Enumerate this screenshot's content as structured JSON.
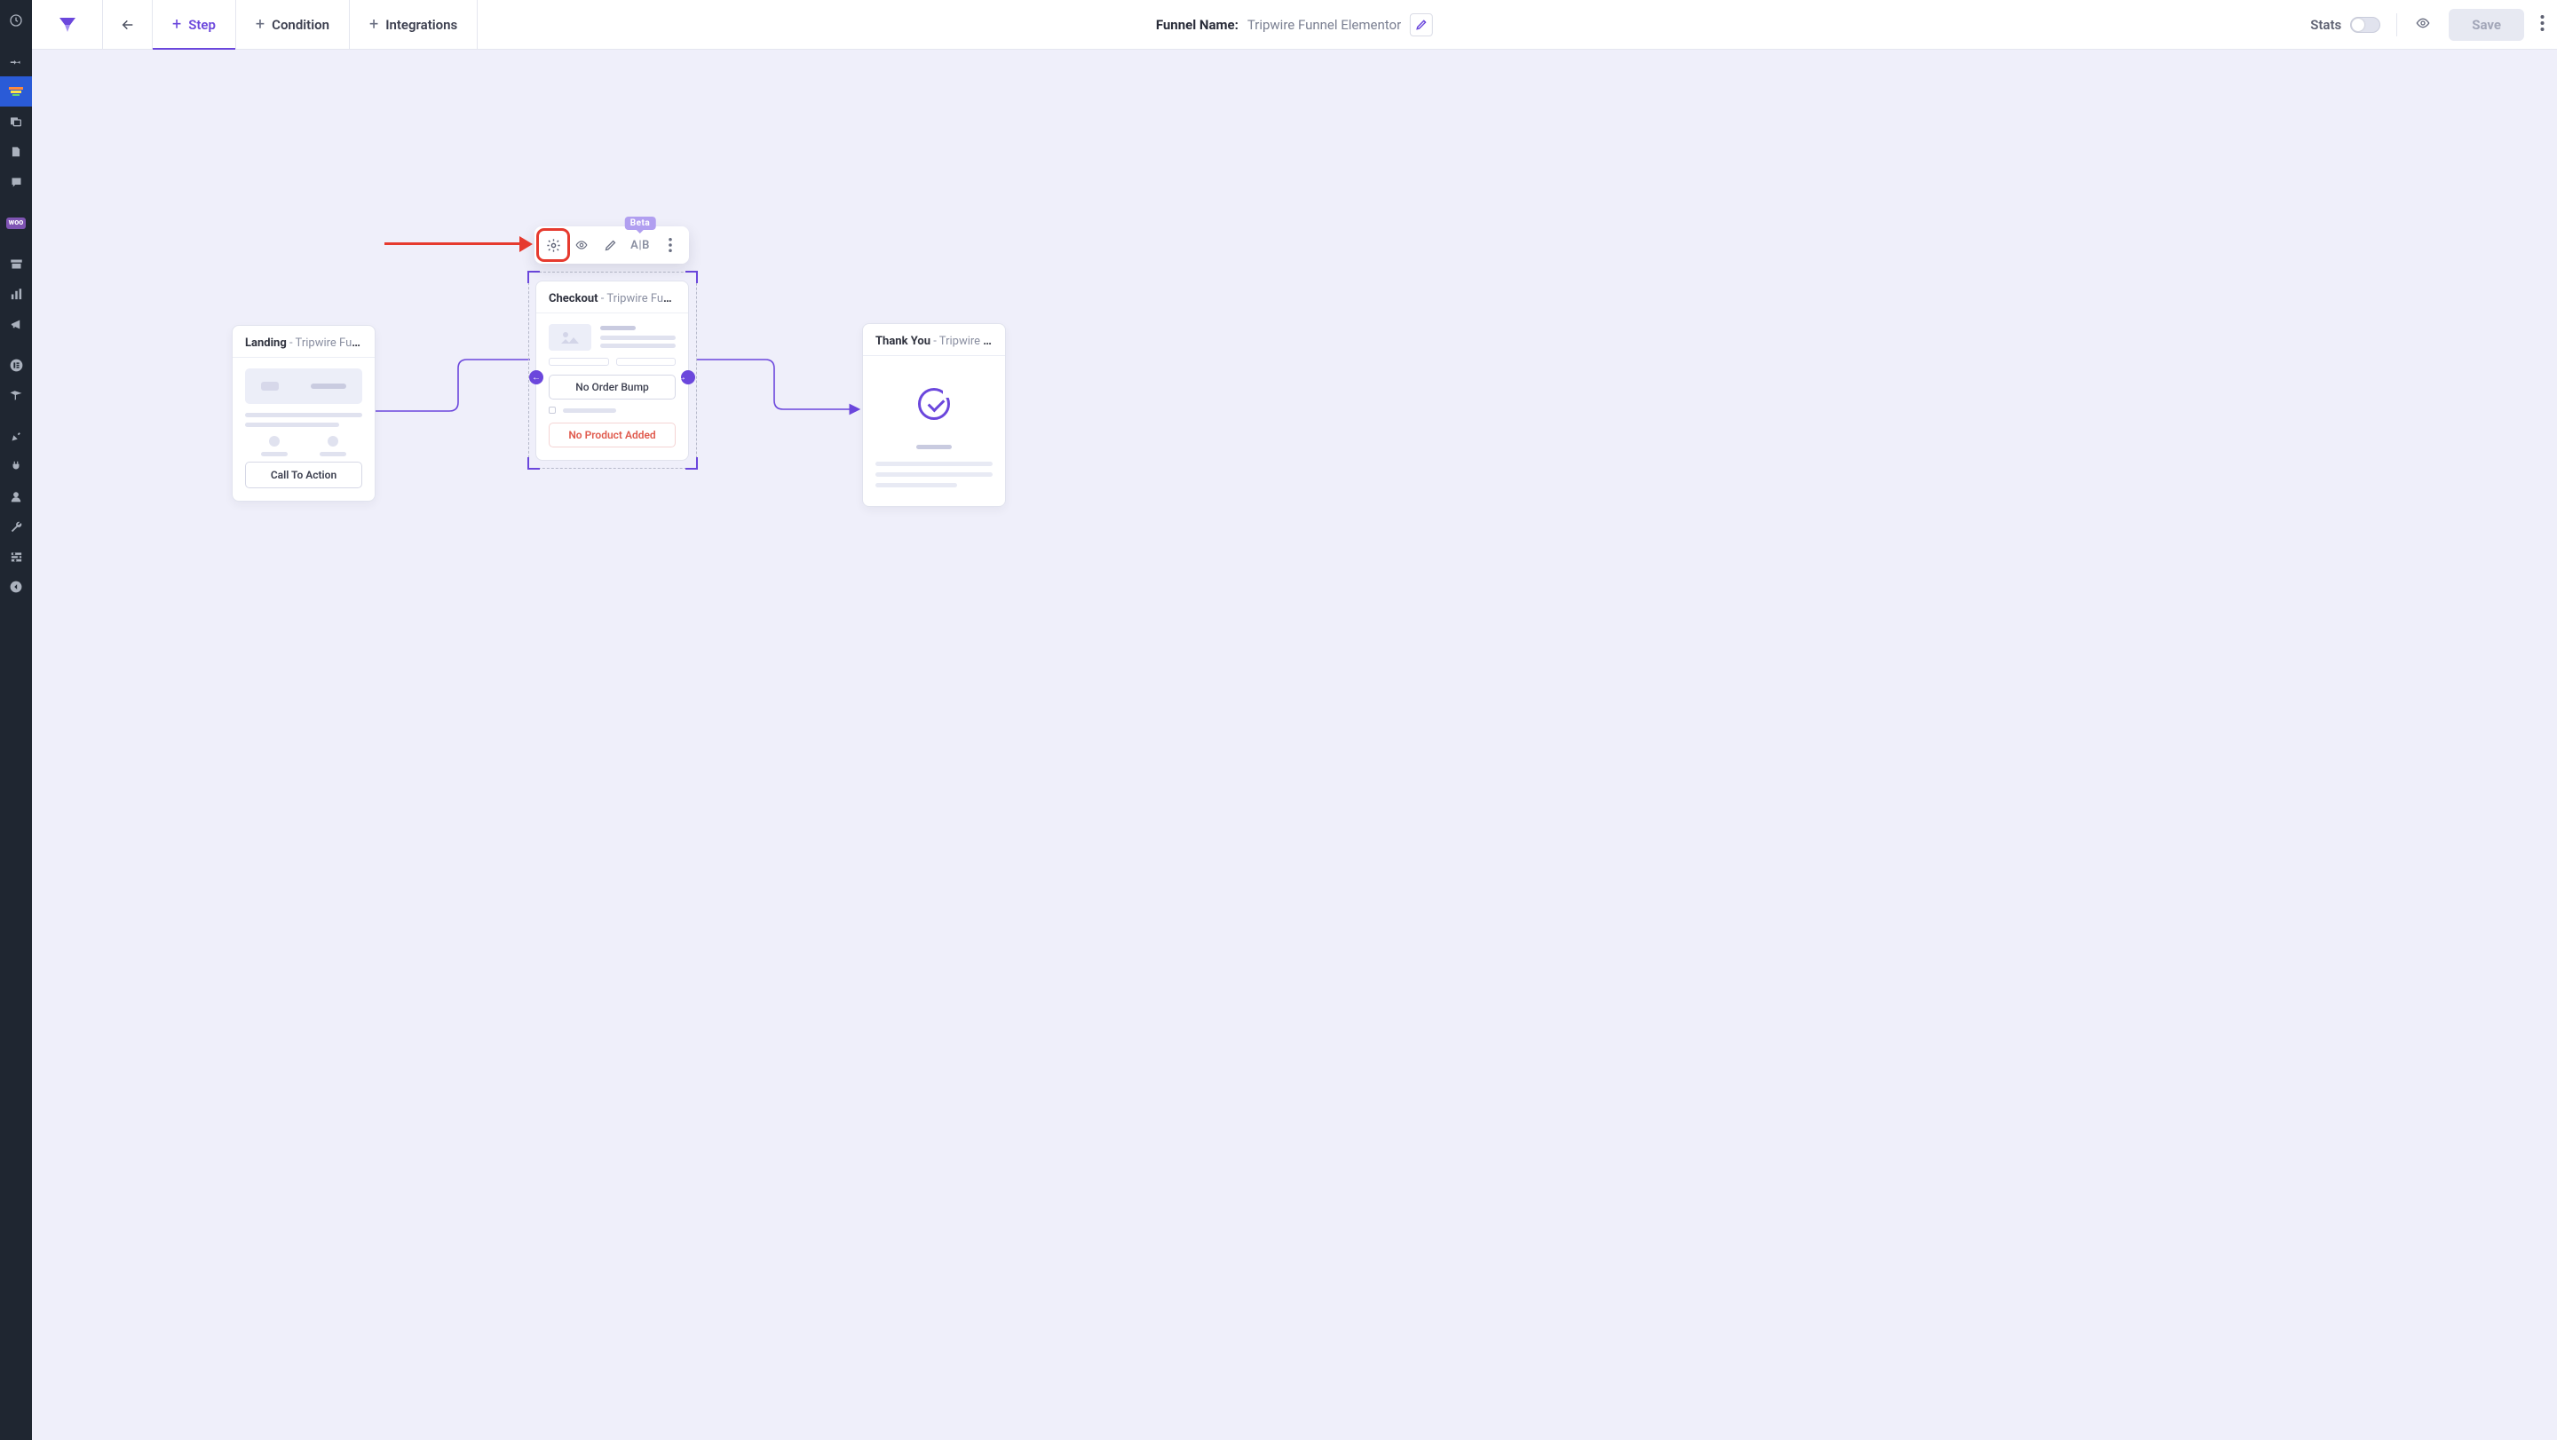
{
  "header": {
    "funnel_label": "Funnel Name:",
    "funnel_value": "Tripwire Funnel Elementor",
    "stats_label": "Stats",
    "save_label": "Save",
    "tabs": {
      "step": "Step",
      "condition": "Condition",
      "integrations": "Integrations"
    }
  },
  "toolbar": {
    "beta_badge": "Beta",
    "ab_label": "A|B"
  },
  "annotation": {
    "color": "#e63a2e"
  },
  "nodes": {
    "landing": {
      "title": "Landing",
      "subtitle": " - Tripwire Funne…",
      "cta": "Call To Action"
    },
    "checkout": {
      "title": "Checkout",
      "subtitle": " - Tripwire Funne…",
      "no_bump": "No Order Bump",
      "no_product": "No Product Added"
    },
    "thankyou": {
      "title": "Thank You",
      "subtitle": " - Tripwire Funne…"
    }
  },
  "colors": {
    "brand": "#6b47dc",
    "dark_sidebar": "#1f2631",
    "active_sidebar": "#2a5bd7",
    "danger": "#e05b4e",
    "annotation": "#e63a2e"
  }
}
